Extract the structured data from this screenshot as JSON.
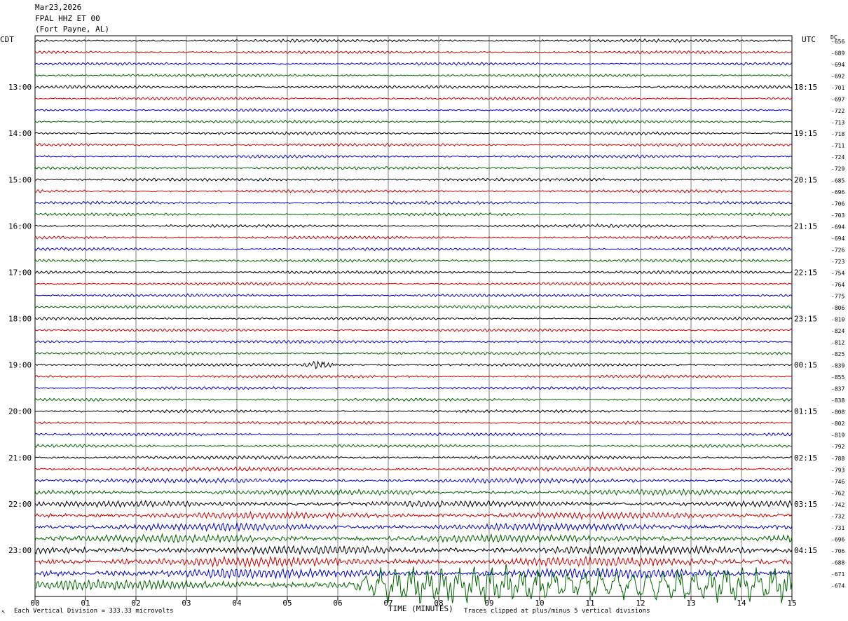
{
  "header": {
    "date": "Mar23,2026",
    "station": "FPAL HHZ ET 00",
    "location": "(Fort Payne, AL)"
  },
  "left_tz": "CDT",
  "right_tz": "UTC",
  "dc_header": "DC",
  "footer": {
    "scale": "Each Vertical Division =  333.33 microvolts",
    "clip": "Traces clipped at plus/minus 5 vertical divisions"
  },
  "colors": {
    "cycle": [
      "#000000",
      "#cc0000",
      "#0000cc",
      "#006400"
    ],
    "grid": "#808080"
  },
  "chart_data": {
    "type": "line",
    "title": "",
    "xlabel": "TIME (MINUTES)",
    "x_ticks": [
      "00",
      "01",
      "02",
      "03",
      "04",
      "05",
      "06",
      "07",
      "08",
      "09",
      "10",
      "11",
      "12",
      "13",
      "14",
      "15"
    ],
    "xlim": [
      0,
      15
    ],
    "left_hour_labels": [
      "13:00",
      "14:00",
      "15:00",
      "16:00",
      "17:00",
      "18:00",
      "19:00",
      "20:00",
      "21:00",
      "22:00",
      "23:00"
    ],
    "right_hour_labels": [
      "18:15",
      "19:15",
      "20:15",
      "21:15",
      "22:15",
      "23:15",
      "00:15",
      "01:15",
      "02:15",
      "03:15",
      "04:15"
    ],
    "trace_count": 48,
    "dc_offsets": [
      "-656",
      "-689",
      "-694",
      "-692",
      "-701",
      "-697",
      "-722",
      "-713",
      "-718",
      "-711",
      "-724",
      "-729",
      "-685",
      "-696",
      "-706",
      "-703",
      "-694",
      "-694",
      "-726",
      "-723",
      "-754",
      "-764",
      "-775",
      "-806",
      "-810",
      "-824",
      "-812",
      "-825",
      "-839",
      "-855",
      "-837",
      "-838",
      "-808",
      "-802",
      "-819",
      "-792",
      "-788",
      "-793",
      "-746",
      "-762",
      "-742",
      "-732",
      "-731",
      "-696",
      "-706",
      "-688",
      "-671",
      "-674"
    ],
    "events": [
      {
        "trace": 28,
        "minute": 5.65,
        "note": "local event burst"
      },
      {
        "trace": 47,
        "minute": 6.3,
        "note": "clipped large signal (teleseism)"
      }
    ]
  }
}
